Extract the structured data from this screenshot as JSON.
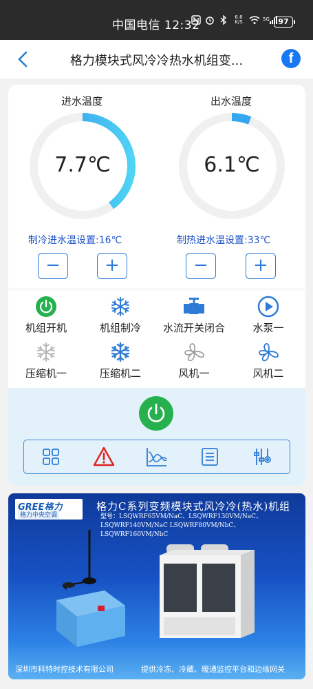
{
  "status_bar": {
    "carrier_time": "中国电信 12:32",
    "battery": "97",
    "icons": [
      "nfc-icon",
      "alarm-icon",
      "bluetooth-icon",
      "network-speed-icon",
      "wifi-icon",
      "signal-5g-icon"
    ],
    "speed": "6.6 K/S",
    "signal": "5G"
  },
  "header": {
    "title": "格力模块式风冷冷热水机组变...",
    "share_icon_glyph": "f"
  },
  "gauges": [
    {
      "label": "进水温度",
      "value": "7.7℃",
      "fill_fraction": 0.4
    },
    {
      "label": "出水温度",
      "value": "6.1℃",
      "fill_fraction": 0.06
    }
  ],
  "settings": {
    "cooling_label": "制冷进水温设置:16℃",
    "heating_label": "制热进水温设置:33℃",
    "minus": "−",
    "plus": "+"
  },
  "status_items": [
    {
      "label": "机组开机",
      "icon": "power-on-icon",
      "active": true
    },
    {
      "label": "机组制冷",
      "icon": "snowflake-icon",
      "active": true
    },
    {
      "label": "水流开关闭合",
      "icon": "water-valve-icon",
      "active": true
    },
    {
      "label": "水泵一",
      "icon": "pump-icon",
      "active": true
    },
    {
      "label": "压缩机一",
      "icon": "snowflake-icon",
      "active": false
    },
    {
      "label": "压缩机二",
      "icon": "snowflake-icon",
      "active": true
    },
    {
      "label": "风机一",
      "icon": "fan-icon",
      "active": false
    },
    {
      "label": "风机二",
      "icon": "fan-icon",
      "active": true
    }
  ],
  "toolbar": [
    "grid-icon",
    "warning-icon",
    "chart-icon",
    "list-icon",
    "sliders-icon"
  ],
  "colors": {
    "accent": "#2d7bd6",
    "setting_text": "#1a52c9",
    "power_green": "#27b14e",
    "gauge_track": "#f0f0f0",
    "gauge_fill": "#33b5f0"
  },
  "banner": {
    "logo": "GREE格力",
    "logo_sub": "格力中央空调",
    "title": "格力C系列变频模块式风冷冷(热水)机组",
    "model": "型号：LSQWRF65VM/NaC、LSQWRF130VM/NaC、LSQWRF140VM/NaC LSQWRF80VM/NbC、LSQWRF160VM/NbC",
    "footer_left": "深圳市科特时控技术有限公司",
    "footer_right": "提供冷冻、冷藏、暖通监控平台和边缘网关"
  }
}
